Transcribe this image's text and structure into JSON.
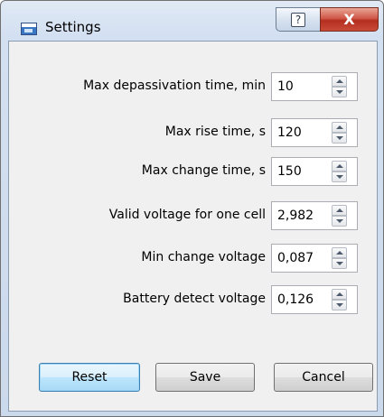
{
  "window": {
    "title": "Settings",
    "help_glyph": "?",
    "close_glyph": "X"
  },
  "form": {
    "rows": [
      {
        "label": "Max depassivation time, min",
        "value": "10"
      },
      {
        "label": "Max rise time, s",
        "value": "120"
      },
      {
        "label": "Max change time, s",
        "value": "150"
      },
      {
        "label": "Valid voltage for one cell",
        "value": "2,982"
      },
      {
        "label": "Min change voltage",
        "value": "0,087"
      },
      {
        "label": "Battery detect voltage",
        "value": "0,126"
      }
    ]
  },
  "buttons": {
    "reset": "Reset",
    "save": "Save",
    "cancel": "Cancel"
  },
  "icons": {
    "app": "window-app-icon",
    "help": "help-icon",
    "close": "close-icon",
    "spin_up": "arrow-up-icon",
    "spin_down": "arrow-down-icon"
  }
}
